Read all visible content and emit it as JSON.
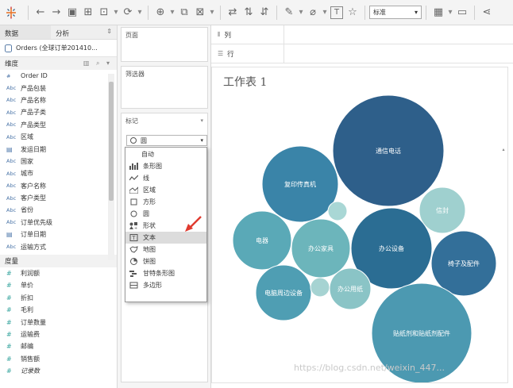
{
  "toolbar": {
    "size_select": "标准"
  },
  "datapane": {
    "tabs": [
      "数据",
      "分析"
    ],
    "datasource": "Orders (全球订单201410...",
    "dimensions_header": "维度",
    "dimensions": [
      {
        "type": "#",
        "name": "Order ID"
      },
      {
        "type": "Abc",
        "name": "产品包装"
      },
      {
        "type": "Abc",
        "name": "产品名称"
      },
      {
        "type": "Abc",
        "name": "产品子类"
      },
      {
        "type": "Abc",
        "name": "产品类型"
      },
      {
        "type": "Abc",
        "name": "区域"
      },
      {
        "type": "date",
        "name": "发运日期"
      },
      {
        "type": "Abc",
        "name": "国家"
      },
      {
        "type": "Abc",
        "name": "城市"
      },
      {
        "type": "Abc",
        "name": "客户名称"
      },
      {
        "type": "Abc",
        "name": "客户类型"
      },
      {
        "type": "Abc",
        "name": "省份"
      },
      {
        "type": "Abc",
        "name": "订单优先级"
      },
      {
        "type": "date",
        "name": "订单日期"
      },
      {
        "type": "Abc",
        "name": "运输方式"
      }
    ],
    "measures_header": "度量",
    "measures": [
      {
        "name": "利润额"
      },
      {
        "name": "单价"
      },
      {
        "name": "折扣"
      },
      {
        "name": "毛利"
      },
      {
        "name": "订单数量"
      },
      {
        "name": "运输费"
      },
      {
        "name": "邮编"
      },
      {
        "name": "销售额"
      },
      {
        "name": "记录数"
      }
    ]
  },
  "midpane": {
    "pages_label": "页面",
    "filters_label": "筛选器",
    "marks_label": "标记",
    "mark_type": "圆",
    "dropdown": [
      {
        "icon": "",
        "label": "自动"
      },
      {
        "icon": "bar",
        "label": "条形图"
      },
      {
        "icon": "line",
        "label": "线"
      },
      {
        "icon": "area",
        "label": "区域"
      },
      {
        "icon": "square",
        "label": "方形"
      },
      {
        "icon": "circle",
        "label": "圆"
      },
      {
        "icon": "shape",
        "label": "形状"
      },
      {
        "icon": "text",
        "label": "文本"
      },
      {
        "icon": "map",
        "label": "地图"
      },
      {
        "icon": "pie",
        "label": "饼图"
      },
      {
        "icon": "gantt",
        "label": "甘特条形图"
      },
      {
        "icon": "polygon",
        "label": "多边形"
      }
    ],
    "highlighted": "文本"
  },
  "shelves": {
    "columns_label": "列",
    "rows_label": "行"
  },
  "viz": {
    "title": "工作表 1",
    "bubbles": [
      {
        "label": "通信电话",
        "color": "#2e5f8a"
      },
      {
        "label": "复印传真机",
        "color": "#3a84a8"
      },
      {
        "label": "信封",
        "color": "#9fd0cf"
      },
      {
        "label": "",
        "color": "#a9d7d5"
      },
      {
        "label": "电器",
        "color": "#5aa9b7"
      },
      {
        "label": "办公家具",
        "color": "#6cb5bb"
      },
      {
        "label": "办公设备",
        "color": "#2b6d93"
      },
      {
        "label": "椅子及配件",
        "color": "#336f99"
      },
      {
        "label": "电脑周边设备",
        "color": "#4f9eb3"
      },
      {
        "label": "",
        "color": "#a6d3d2"
      },
      {
        "label": "办公用纸",
        "color": "#8ac4c6"
      },
      {
        "label": "贴纸剂和贴纸剂配件",
        "color": "#4c99b1"
      }
    ]
  },
  "watermark": "https://blog.csdn.net/weixin_447..."
}
